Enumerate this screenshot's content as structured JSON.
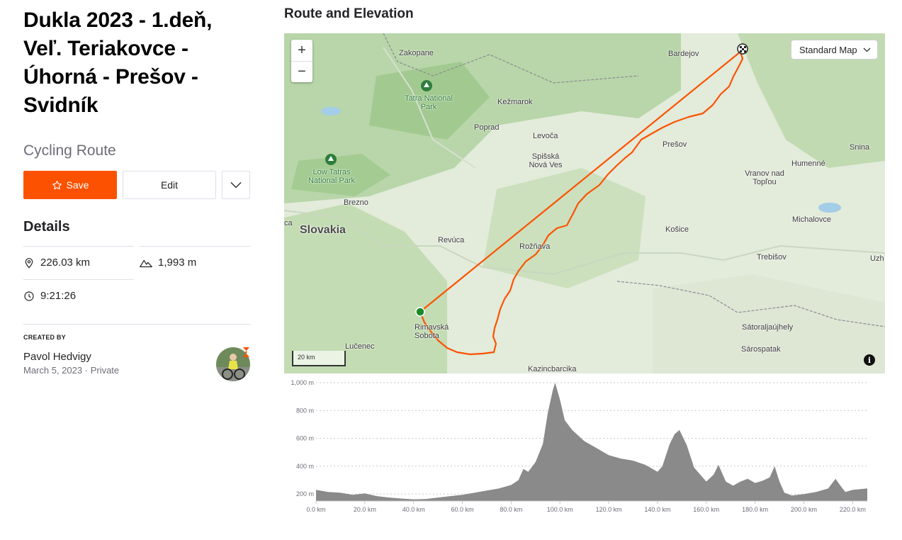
{
  "route": {
    "title": "Dukla 2023 - 1.deň, Veľ. Teriakovce - Úhorná - Prešov - Svidník",
    "type": "Cycling Route"
  },
  "actions": {
    "save_label": "Save",
    "edit_label": "Edit"
  },
  "details": {
    "heading": "Details",
    "distance": "226.03 km",
    "elevation_gain": "1,993 m",
    "time": "9:21:26"
  },
  "creator": {
    "label": "CREATED BY",
    "name": "Pavol Hedvigy",
    "date": "March 5, 2023",
    "visibility": "Private"
  },
  "section_title": "Route and Elevation",
  "map": {
    "style_select": "Standard Map",
    "scale_label": "20 km",
    "labels": {
      "zakopane": "Zakopane",
      "bardejov": "Bardejov",
      "tatra_np": "Tatra National Park",
      "kezmarok": "Kežmarok",
      "poprad": "Poprad",
      "levoca": "Levoča",
      "presov": "Prešov",
      "snina": "Snina",
      "low_tatras": "Low Tatras National Park",
      "spisska": "Spišská Nová Ves",
      "humenne": "Humenné",
      "vranov": "Vranov nad Topľou",
      "brezno": "Brezno",
      "ca": "ca",
      "slovakia": "Slovakia",
      "michalovce": "Michalovce",
      "kosice": "Košice",
      "revuca": "Revúca",
      "roznava": "Rožňava",
      "trebisov": "Trebišov",
      "uzh": "Uzh",
      "rimavska": "Rimavská Sobota",
      "satoraljaujhely": "Sátoraljaújhely",
      "lucenec": "Lučenec",
      "sarospatak": "Sárospatak",
      "kazincbarcika": "Kazincbarcika"
    },
    "colors": {
      "route": "#fc5200",
      "start": "#1a8a2a"
    }
  },
  "chart_data": {
    "type": "area",
    "title": "",
    "xlabel": "",
    "ylabel": "",
    "xlim": [
      0,
      226
    ],
    "ylim": [
      150,
      1000
    ],
    "x_ticks": [
      "0.0 km",
      "20.0 km",
      "40.0 km",
      "60.0 km",
      "80.0 km",
      "100.0 km",
      "120.0 km",
      "140.0 km",
      "160.0 km",
      "180.0 km",
      "200.0 km",
      "220.0 km"
    ],
    "y_ticks": [
      "200 m",
      "400 m",
      "600 m",
      "800 m",
      "1,000 m"
    ],
    "grid": true,
    "series": [
      {
        "x": [
          0,
          5,
          10,
          15,
          20,
          25,
          30,
          35,
          40,
          45,
          50,
          55,
          60,
          65,
          70,
          75,
          80,
          83,
          85,
          87,
          90,
          93,
          95,
          97,
          98,
          100,
          102,
          105,
          110,
          115,
          120,
          125,
          130,
          135,
          138,
          140,
          142,
          145,
          147,
          149,
          152,
          155,
          158,
          160,
          163,
          165,
          168,
          171,
          174,
          177,
          180,
          183,
          186,
          188,
          190,
          192,
          195,
          200,
          205,
          210,
          213,
          215,
          217,
          220,
          226
        ],
        "y": [
          230,
          215,
          210,
          195,
          205,
          185,
          175,
          168,
          162,
          165,
          175,
          185,
          195,
          210,
          225,
          240,
          265,
          300,
          380,
          360,
          430,
          560,
          780,
          940,
          1000,
          880,
          730,
          660,
          580,
          530,
          480,
          455,
          440,
          410,
          380,
          360,
          400,
          560,
          630,
          660,
          550,
          390,
          330,
          290,
          340,
          410,
          290,
          260,
          290,
          310,
          280,
          295,
          320,
          400,
          290,
          210,
          190,
          200,
          215,
          240,
          310,
          260,
          215,
          230,
          240
        ]
      }
    ]
  }
}
